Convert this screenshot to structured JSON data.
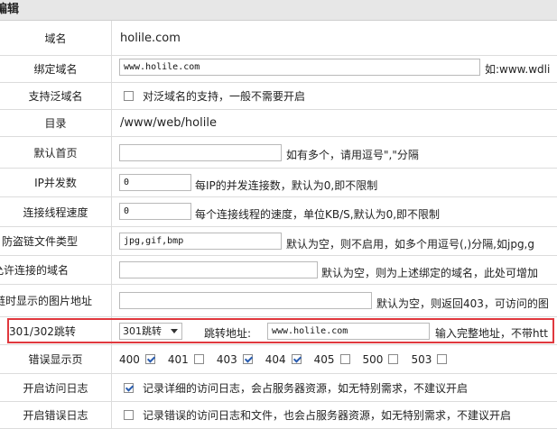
{
  "section_title": "编辑",
  "rows": {
    "domain": {
      "label": "域名",
      "value": "holile.com"
    },
    "bind_domain": {
      "label": "绑定域名",
      "value": "www.holile.com",
      "hint": "如:www.wdli"
    },
    "wildcard": {
      "label": "支持泛域名",
      "checkbox_text": "对泛域名的支持，一般不需要开启"
    },
    "directory": {
      "label": "目录",
      "value": "/www/web/holile"
    },
    "default_page": {
      "label": "默认首页",
      "value": "",
      "hint": "如有多个，请用逗号\",\"分隔"
    },
    "ip_concurrency": {
      "label": "IP并发数",
      "value": "0",
      "hint": "每IP的并发连接数，默认为0,即不限制"
    },
    "conn_speed": {
      "label": "连接线程速度",
      "value": "0",
      "hint": "每个连接线程的速度，单位KB/S,默认为0,即不限制"
    },
    "hotlink_types": {
      "label": "防盗链文件类型",
      "value": "jpg,gif,bmp",
      "hint": "默认为空，则不启用，如多个用逗号(,)分隔,如jpg,g"
    },
    "allowed_domains": {
      "label": "允许连接的域名",
      "value": "",
      "hint": "默认为空，则为上述绑定的域名，此处可增加"
    },
    "hotlink_image": {
      "label": "链时显示的图片地址",
      "value": "",
      "hint": "默认为空，则返回403，可访问的图"
    },
    "redirect": {
      "label": "301/302跳转",
      "select_value": "301跳转",
      "target_label": "跳转地址:",
      "target_value": "www.holile.com",
      "hint": "输入完整地址，不带htt"
    },
    "error_pages": {
      "label": "错误显示页",
      "items": [
        {
          "code": "400",
          "checked": true
        },
        {
          "code": "401",
          "checked": false
        },
        {
          "code": "403",
          "checked": true
        },
        {
          "code": "404",
          "checked": true
        },
        {
          "code": "405",
          "checked": false
        },
        {
          "code": "500",
          "checked": false
        },
        {
          "code": "503",
          "checked": false
        }
      ]
    },
    "access_log": {
      "label": "开启访问日志",
      "checked": true,
      "checkbox_text": "记录详细的访问日志，会占服务器资源，如无特别需求，不建议开启"
    },
    "error_log": {
      "label": "开启错误日志",
      "checked": false,
      "checkbox_text": "记录错误的访问日志和文件，也会占服务器资源，如无特别需求，不建议开启"
    }
  }
}
